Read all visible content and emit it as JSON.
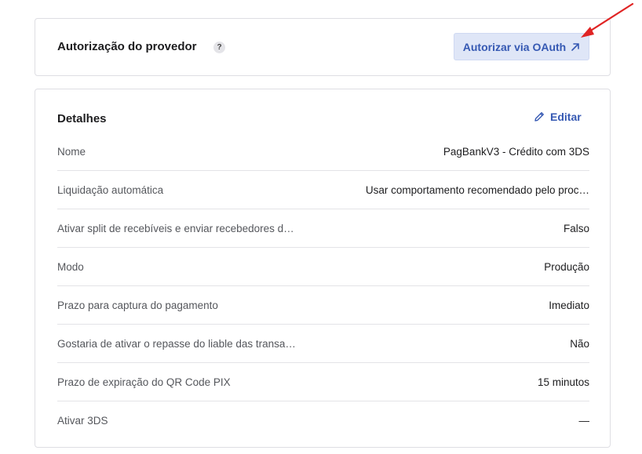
{
  "auth": {
    "title": "Autorização do provedor",
    "help_glyph": "?",
    "oauth_button_label": "Autorizar via OAuth"
  },
  "details": {
    "title": "Detalhes",
    "edit_label": "Editar",
    "rows": [
      {
        "label": "Nome",
        "value": "PagBankV3 - Crédito com 3DS"
      },
      {
        "label": "Liquidação automática",
        "value": "Usar comportamento recomendado pelo proc…"
      },
      {
        "label": "Ativar split de recebíveis e enviar recebedores d…",
        "value": "Falso"
      },
      {
        "label": "Modo",
        "value": "Produção"
      },
      {
        "label": "Prazo para captura do pagamento",
        "value": "Imediato"
      },
      {
        "label": "Gostaria de ativar o repasse do liable das transa…",
        "value": "Não"
      },
      {
        "label": "Prazo de expiração do QR Code PIX",
        "value": "15 minutos"
      },
      {
        "label": "Ativar 3DS",
        "value": "—"
      }
    ]
  },
  "colors": {
    "accent": "#3659b3",
    "button_bg": "#dfe6f7",
    "annotation_arrow": "#e02424"
  }
}
